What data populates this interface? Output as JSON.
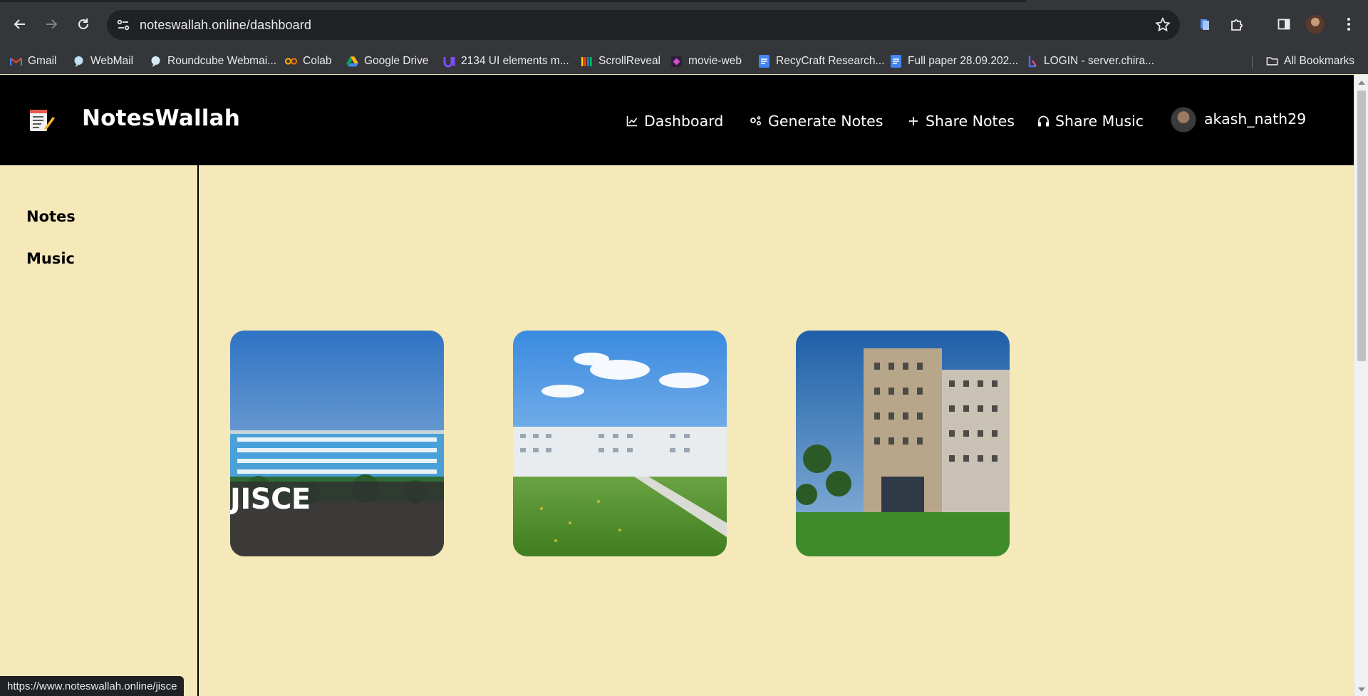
{
  "browser": {
    "url": "noteswallah.online/dashboard",
    "bookmarks": [
      {
        "label": "Gmail",
        "icon": "gmail-icon"
      },
      {
        "label": "WebMail",
        "icon": "webmail-icon"
      },
      {
        "label": "Roundcube Webmai...",
        "icon": "roundcube-icon"
      },
      {
        "label": "Colab",
        "icon": "colab-icon"
      },
      {
        "label": "Google Drive",
        "icon": "google-drive-icon"
      },
      {
        "label": "2134 UI elements m...",
        "icon": "uiverse-icon"
      },
      {
        "label": "ScrollReveal",
        "icon": "scrollreveal-icon"
      },
      {
        "label": "movie-web",
        "icon": "movie-web-icon"
      },
      {
        "label": "RecyCraft Research...",
        "icon": "google-docs-icon"
      },
      {
        "label": "Full paper 28.09.202...",
        "icon": "google-docs-icon"
      },
      {
        "label": "LOGIN - server.chira...",
        "icon": "login-site-icon"
      }
    ],
    "all_bookmarks_label": "All Bookmarks",
    "status_url": "https://www.noteswallah.online/jisce"
  },
  "header": {
    "brand": "NotesWallah",
    "nav": {
      "dashboard": "Dashboard",
      "generate_notes": "Generate Notes",
      "share_notes": "Share Notes",
      "share_music": "Share Music"
    },
    "username": "akash_nath29"
  },
  "sidebar": {
    "items": [
      {
        "label": "Notes"
      },
      {
        "label": "Music"
      }
    ]
  },
  "cards": [
    {
      "title": "JISCE"
    },
    {
      "title": ""
    },
    {
      "title": ""
    }
  ],
  "colors": {
    "page_background": "#f5e8b9",
    "header_background": "#000000",
    "browser_chrome": "#35363a"
  }
}
